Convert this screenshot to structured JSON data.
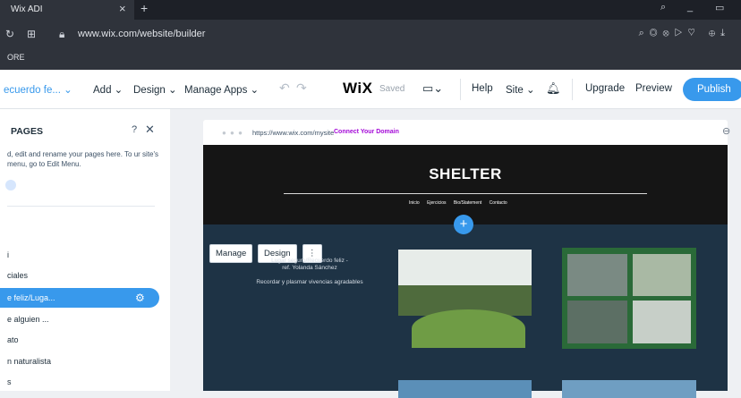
{
  "browser": {
    "tab_title": "Wix ADI",
    "tab_close": "×",
    "new_tab": "+",
    "url": "www.wix.com/website/builder",
    "bookmark_item": "ORE"
  },
  "topbar": {
    "page_selector": "ecuerdo fe... ⌄",
    "add": "Add ⌄",
    "design": "Design ⌄",
    "manage_apps": "Manage Apps ⌄",
    "logo": "WiX",
    "saved": "Saved",
    "help": "Help",
    "site": "Site ⌄",
    "upgrade": "Upgrade",
    "preview": "Preview",
    "publish": "Publish"
  },
  "pages_panel": {
    "title": "PAGES",
    "help": "?",
    "close": "✕",
    "description": "d, edit and rename your pages here. To ur site's menu, go to Edit Menu.",
    "items": [
      {
        "label": "i"
      },
      {
        "label": "ciales"
      },
      {
        "label": "e feliz/Luga..."
      },
      {
        "label": "e alguien ..."
      },
      {
        "label": "ato"
      },
      {
        "label": "n naturalista"
      },
      {
        "label": "s"
      }
    ],
    "selected_index": 2
  },
  "site_preview": {
    "url": "https://www.wix.com/mysite",
    "connect_domain": "Connect Your Domain",
    "site_title": "SHELTER",
    "menu": [
      "Inicio",
      "Ejercicios",
      "Bio/Statement",
      "Contacto"
    ],
    "controls": {
      "manage": "Manage",
      "design": "Design",
      "more": "⋮"
    },
    "bio_line1": "Lugar seguro/Recuerdo feliz -",
    "bio_line2": "ref. Yolanda Sánchez",
    "bio_line3": "Recordar y plasmar vivencias agradables"
  },
  "colors": {
    "accent": "#3899ec",
    "chrome_dark": "#2f333b",
    "site_header": "#151515",
    "site_body": "#1e3345",
    "collage_green": "#2a6a38"
  }
}
